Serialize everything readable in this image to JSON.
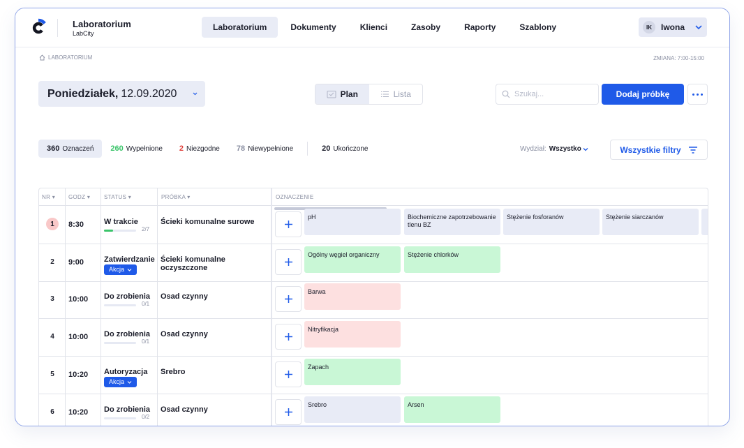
{
  "header": {
    "app_title": "Laboratorium",
    "app_subtitle": "LabCity",
    "nav": [
      {
        "label": "Laboratorium",
        "active": true
      },
      {
        "label": "Dokumenty",
        "active": false
      },
      {
        "label": "Klienci",
        "active": false
      },
      {
        "label": "Zasoby",
        "active": false
      },
      {
        "label": "Raporty",
        "active": false
      },
      {
        "label": "Szablony",
        "active": false
      }
    ],
    "user": {
      "initials": "IK",
      "name": "Iwona"
    }
  },
  "breadcrumb": "LABORATORIUM",
  "shift": "ZMIANA: 7:00-15:00",
  "date": {
    "day": "Poniedziałek,",
    "value": "12.09.2020"
  },
  "view": {
    "plan": "Plan",
    "list": "Lista",
    "active": "plan"
  },
  "search": {
    "placeholder": "Szukaj..."
  },
  "add_button": "Dodaj próbkę",
  "stats": [
    {
      "count": "360",
      "label": "Oznaczeń",
      "color": "#1b1d2a",
      "active": true
    },
    {
      "count": "260",
      "label": "Wypełnione",
      "color": "#3bc46a",
      "active": false
    },
    {
      "count": "2",
      "label": "Niezgodne",
      "color": "#e0413c",
      "active": false
    },
    {
      "count": "78",
      "label": "Niewypełnione",
      "color": "#8a8fa2",
      "active": false
    },
    {
      "count": "20",
      "label": "Ukończone",
      "color": "#1b1d2a",
      "active": false
    }
  ],
  "department": {
    "label": "Wydział:",
    "value": "Wszystko"
  },
  "filters_button": "Wszystkie filtry",
  "table": {
    "headers": {
      "nr": "NR",
      "godz": "GODZ",
      "status": "STATUS",
      "probka": "PRÓBKA",
      "oznaczenie": "OZNACZENIE"
    },
    "rows": [
      {
        "nr": "1",
        "time": "8:30",
        "status": "W trakcie",
        "progress": "2/7",
        "progress_fraction": 0.2857,
        "action": null,
        "sample": "Ścieki komunalne surowe",
        "alert": true,
        "tests": [
          {
            "name": "pH",
            "state": "blue"
          },
          {
            "name": "Biochemiczne zapotrzebowanie tlenu BZ",
            "state": "blue"
          },
          {
            "name": "Stężenie fosforanów",
            "state": "blue"
          },
          {
            "name": "Stężenie siarczanów",
            "state": "blue"
          },
          {
            "name": "",
            "state": "blue"
          }
        ]
      },
      {
        "nr": "2",
        "time": "9:00",
        "status": "Zatwierdzanie",
        "progress": null,
        "progress_fraction": null,
        "action": "Akcja",
        "sample": "Ścieki komunalne oczyszczone",
        "alert": false,
        "tests": [
          {
            "name": "Ogólny węgiel organiczny",
            "state": "green"
          },
          {
            "name": "Stężenie chlorków",
            "state": "green"
          }
        ]
      },
      {
        "nr": "3",
        "time": "10:00",
        "status": "Do zrobienia",
        "progress": "0/1",
        "progress_fraction": 0,
        "action": null,
        "sample": "Osad czynny",
        "alert": false,
        "tests": [
          {
            "name": "Barwa",
            "state": "red"
          }
        ]
      },
      {
        "nr": "4",
        "time": "10:00",
        "status": "Do zrobienia",
        "progress": "0/1",
        "progress_fraction": 0,
        "action": null,
        "sample": "Osad czynny",
        "alert": false,
        "tests": [
          {
            "name": "Nitryfikacja",
            "state": "red"
          }
        ]
      },
      {
        "nr": "5",
        "time": "10:20",
        "status": "Autoryzacja",
        "progress": null,
        "progress_fraction": null,
        "action": "Akcja",
        "sample": "Srebro",
        "alert": false,
        "tests": [
          {
            "name": "Zapach",
            "state": "green"
          }
        ]
      },
      {
        "nr": "6",
        "time": "10:20",
        "status": "Do zrobienia",
        "progress": "0/2",
        "progress_fraction": 0,
        "action": null,
        "sample": "Osad czynny",
        "alert": false,
        "tests": [
          {
            "name": "Srebro",
            "state": "blue"
          },
          {
            "name": "Arsen",
            "state": "green"
          }
        ]
      }
    ]
  },
  "colors": {
    "accent": "#1f5ae8",
    "done": "#3bc46a",
    "error": "#e0413c",
    "chip_blue": "#e8ebf6",
    "chip_green": "#c9f7d6",
    "chip_red": "#fde0e0"
  },
  "icons": [
    "logo-c-icon",
    "chevron-down-icon",
    "home-icon",
    "calendar-icon",
    "list-icon",
    "search-icon",
    "more-icon",
    "filter-icon",
    "plus-icon",
    "sort-arrow-icon"
  ]
}
